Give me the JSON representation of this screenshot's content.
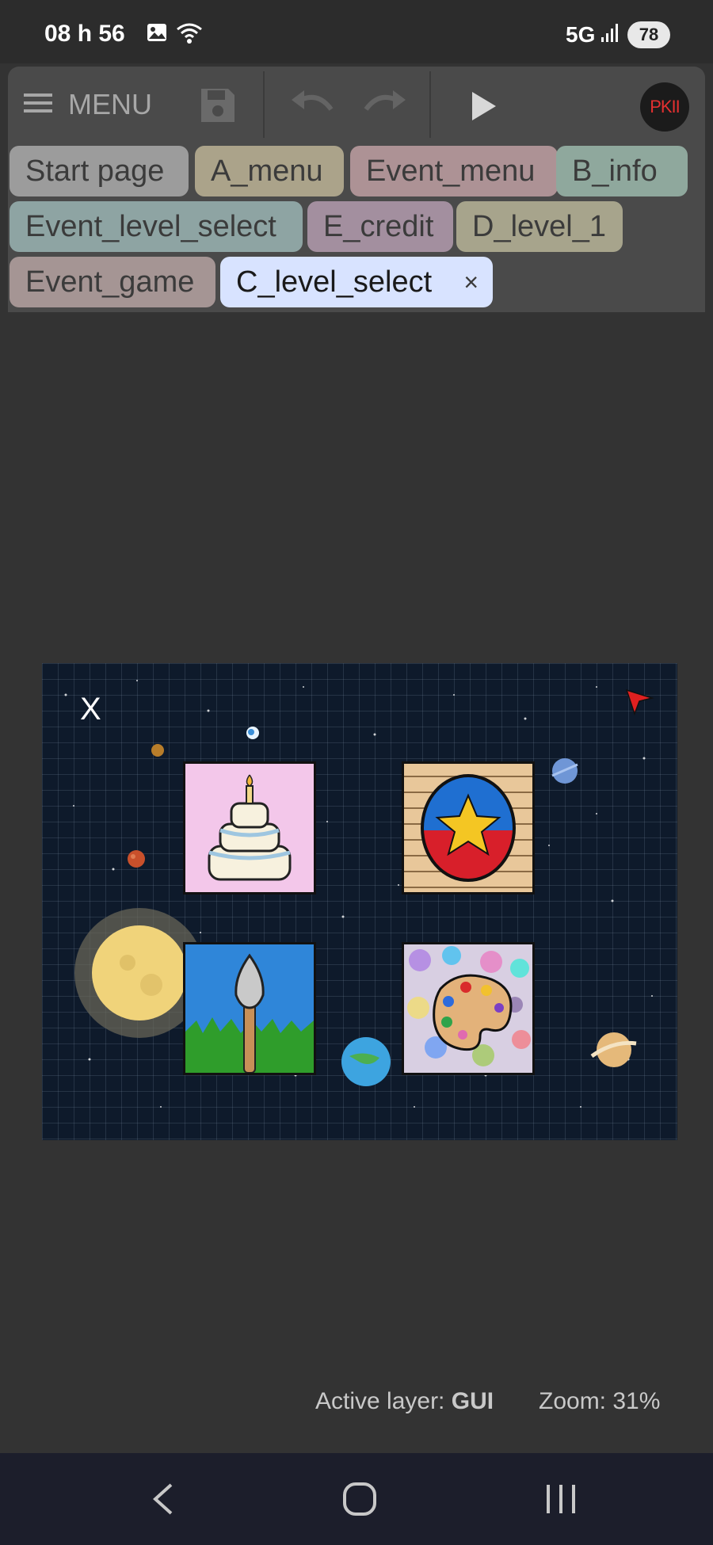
{
  "status_bar": {
    "time": "08 h 56",
    "network": "5G",
    "battery": "78",
    "icons": [
      "image-icon",
      "wifi-icon",
      "signal-icon",
      "battery-icon"
    ]
  },
  "toolbar": {
    "menu_label": "MENU",
    "icons": [
      "hamburger-icon",
      "save-icon",
      "undo-icon",
      "redo-icon",
      "play-icon"
    ],
    "logo_text": "PKII"
  },
  "tabs": [
    {
      "label": "Start page",
      "color": "#9c9c9c",
      "active": false
    },
    {
      "label": "A_menu",
      "color": "#aba38a",
      "active": false
    },
    {
      "label": "Event_menu",
      "color": "#ad9295",
      "active": false
    },
    {
      "label": "B_info",
      "color": "#8fa89d",
      "active": false
    },
    {
      "label": "Event_level_select",
      "color": "#8ea4a3",
      "active": false
    },
    {
      "label": "E_credit",
      "color": "#a38f9f",
      "active": false
    },
    {
      "label": "D_level_1",
      "color": "#a7a48c",
      "active": false
    },
    {
      "label": "Event_game",
      "color": "#a59594",
      "active": false
    },
    {
      "label": "C_level_select",
      "color": "#d8e3ff",
      "active": true,
      "close_icon": "×"
    }
  ],
  "canvas": {
    "close_label": "X",
    "level_tiles": [
      "cake-level",
      "star-level",
      "shovel-level",
      "palette-level"
    ],
    "background_color": "#0e1a2b"
  },
  "footer": {
    "active_layer_label": "Active layer:",
    "active_layer_value": "GUI",
    "zoom_text": "Zoom: 31%"
  },
  "nav_bar": {
    "icons": [
      "back-icon",
      "home-icon",
      "recents-icon"
    ]
  }
}
